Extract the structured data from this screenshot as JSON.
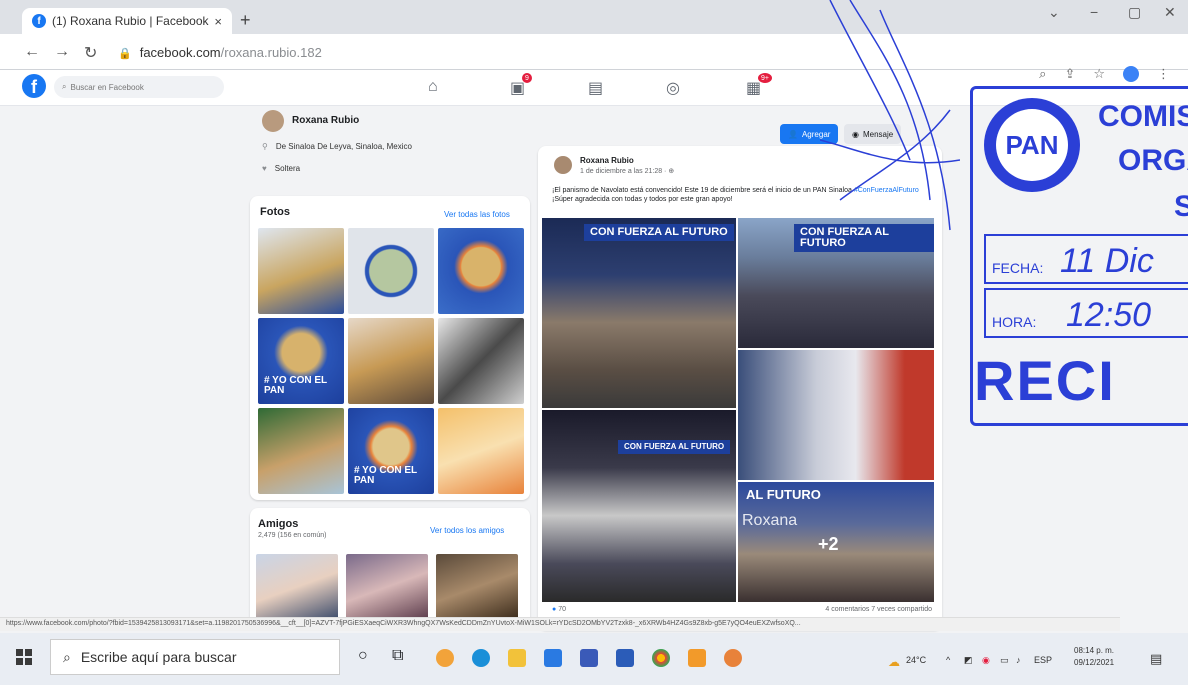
{
  "browser": {
    "tab_title": "(1) Roxana Rubio | Facebook",
    "tab_close": "×",
    "new_tab": "+",
    "url_host": "facebook.com",
    "url_path": "/roxana.rubio.182",
    "status_url": "https://www.facebook.com/photo/?fbid=1539425813093171&set=a.1198201750536996&__cft__[0]=AZVT-7fjPGiESXaeqCiWXR3WhngQX7WsKedCDDmZnYUvtoX-MiW1SOLk=rYDcSD2OMbYV2Tzxk8-_x6XRWb4HZ4Gs9Z8xb-g5E7yQO4euEXZwfsoXQ..."
  },
  "facebook": {
    "search_placeholder": "Buscar en Facebook",
    "nav_badges": [
      "9",
      "9+"
    ],
    "profile_name": "Roxana Rubio",
    "add_friend": "Agregar",
    "message": "Mensaje",
    "intro": {
      "location": "De Sinaloa De Leyva, Sinaloa, Mexico",
      "status": "Soltera"
    },
    "photos": {
      "title": "Fotos",
      "link": "Ver todas las fotos",
      "tile_labels": [
        "# YO CON EL PAN",
        "# YO CON EL PAN"
      ]
    },
    "friends": {
      "title": "Amigos",
      "count": "2,479 (156 en común)",
      "link": "Ver todos los amigos"
    },
    "post": {
      "author": "Roxana Rubio",
      "time": "1 de diciembre a las 21:28 · ",
      "text": "¡El panismo de Navolato está convencido! Este 19 de diciembre será el inicio de un PAN Sinaloa ",
      "hashtag": "#ConFuerzaAlFuturo",
      "text2": " ¡Súper agradecida con todas y todos por este gran apoyo!",
      "banner1": "CON FUERZA AL FUTURO",
      "banner2": "CON FUERZA AL FUTURO",
      "banner3": "CON FUERZA AL FUTURO",
      "banner4": "AL FUTURO",
      "overlay_name": "Roxana",
      "more_photos": "+2",
      "reactions": "70",
      "meta": "4 comentarios  7 veces compartido"
    }
  },
  "stamp": {
    "party": "PAN",
    "line1": "COMIS",
    "line2": "ORGA",
    "line3": "S",
    "fecha_label": "FECHA:",
    "fecha_value": "11 Dic",
    "hora_label": "HORA:",
    "hora_value": "12:50",
    "recibido": "RECI"
  },
  "taskbar": {
    "search_text": "Escribe aquí para buscar",
    "weather": "24°C",
    "lang": "ESP",
    "time": "08:14 p. m.",
    "date": "09/12/2021"
  },
  "colors": {
    "fb_blue": "#1877f2",
    "stamp_blue": "#2b3fd6",
    "badge_red": "#e41e3f"
  }
}
